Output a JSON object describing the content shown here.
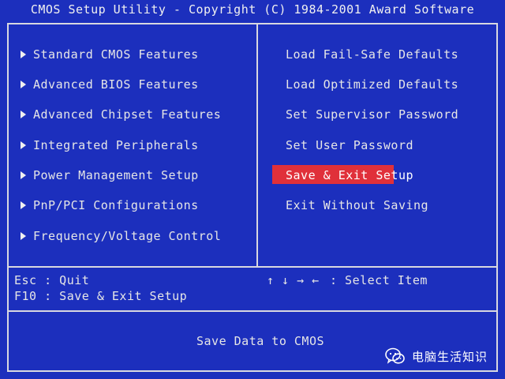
{
  "title": "CMOS Setup Utility - Copyright (C) 1984-2001 Award Software",
  "left_menu": [
    {
      "label": "Standard CMOS Features"
    },
    {
      "label": "Advanced BIOS Features"
    },
    {
      "label": "Advanced Chipset Features"
    },
    {
      "label": "Integrated Peripherals"
    },
    {
      "label": "Power Management Setup"
    },
    {
      "label": "PnP/PCI Configurations"
    },
    {
      "label": "Frequency/Voltage Control"
    }
  ],
  "right_menu": [
    {
      "label": "Load Fail-Safe Defaults"
    },
    {
      "label": "Load Optimized Defaults"
    },
    {
      "label": "Set Supervisor Password"
    },
    {
      "label": "Set User Password"
    },
    {
      "label": "Save & Exit Setup",
      "selected": true
    },
    {
      "label": "Exit Without Saving"
    }
  ],
  "help": {
    "esc": "Esc : Quit",
    "f10": "F10 : Save & Exit Setup",
    "arrows": "↑ ↓ → ←",
    "select": ": Select Item"
  },
  "status": "Save Data to CMOS",
  "watermark": "电脑生活知识",
  "colors": {
    "background": "#1c2fbd",
    "text": "#e6e6e6",
    "highlight": "#e0303a",
    "frame": "#d8d8e0"
  },
  "icons": {
    "menu_arrow": "triangle-right-icon",
    "watermark": "wechat-icon"
  }
}
